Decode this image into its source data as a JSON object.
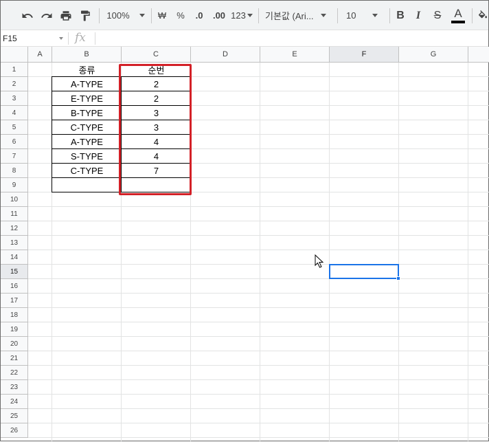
{
  "toolbar": {
    "zoom": "100%",
    "currency": "₩",
    "percent": "%",
    "dec_decrease": ".0",
    "dec_increase": ".00",
    "format_more": "123",
    "font": "기본값 (Ari...",
    "font_size": "10",
    "bold": "B",
    "italic": "I",
    "strike": "S",
    "text_color": "A"
  },
  "formula_bar": {
    "name_box": "F15",
    "fx": "fx",
    "value": ""
  },
  "columns": [
    "A",
    "B",
    "C",
    "D",
    "E",
    "F",
    "G"
  ],
  "rows": [
    "1",
    "2",
    "3",
    "4",
    "5",
    "6",
    "7",
    "8",
    "9",
    "10",
    "11",
    "12",
    "13",
    "14",
    "15",
    "16",
    "17",
    "18",
    "19",
    "20",
    "21",
    "22",
    "23",
    "24",
    "25",
    "26"
  ],
  "selected_cell": "F15",
  "table": {
    "header_b": "종류",
    "header_c": "순번",
    "rows": [
      {
        "b": "A-TYPE",
        "c": "2"
      },
      {
        "b": "E-TYPE",
        "c": "2"
      },
      {
        "b": "B-TYPE",
        "c": "3"
      },
      {
        "b": "C-TYPE",
        "c": "3"
      },
      {
        "b": "A-TYPE",
        "c": "4"
      },
      {
        "b": "S-TYPE",
        "c": "4"
      },
      {
        "b": "C-TYPE",
        "c": "7"
      }
    ]
  },
  "colors": {
    "highlight": "#d32027",
    "selection": "#1a73e8",
    "text_color_bar": "#000000"
  }
}
